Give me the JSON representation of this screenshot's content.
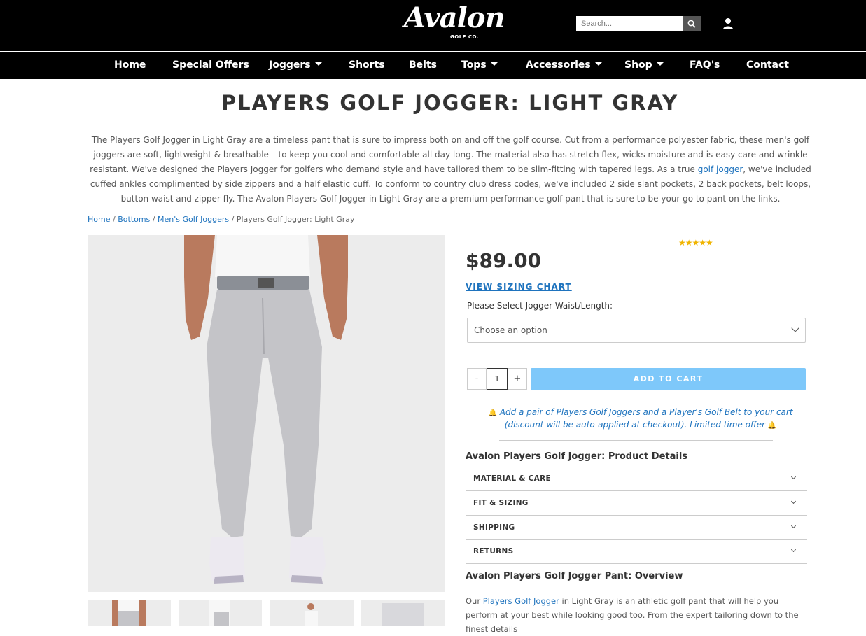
{
  "header": {
    "logo_script": "Avalon",
    "logo_sub": "GOLF CO.",
    "search_placeholder": "Search..."
  },
  "nav": [
    {
      "label": "Home",
      "dropdown": false
    },
    {
      "label": "Special Offers",
      "dropdown": false
    },
    {
      "label": "Joggers",
      "dropdown": true
    },
    {
      "label": "Shorts",
      "dropdown": false
    },
    {
      "label": "Belts",
      "dropdown": false
    },
    {
      "label": "Tops",
      "dropdown": true
    },
    {
      "label": "Accessories",
      "dropdown": true
    },
    {
      "label": "Shop",
      "dropdown": true
    },
    {
      "label": "FAQ's",
      "dropdown": false
    },
    {
      "label": "Contact",
      "dropdown": false
    }
  ],
  "product": {
    "title": "PLAYERS GOLF JOGGER: LIGHT GRAY",
    "desc_part1": "The Players Golf Jogger in Light Gray are a timeless pant that is sure to impress both on and off the golf course. Cut from a performance polyester fabric, these men's golf joggers are soft, lightweight & breathable – to keep you cool and comfortable all day long. The material also has stretch flex, wicks moisture and is easy care and wrinkle resistant. We've designed the Players Jogger for golfers who demand style and have tailored them to be slim-fitting with tapered legs. As a true ",
    "desc_link": "golf jogger",
    "desc_part2": ", we've included cuffed ankles complimented by side zippers and a half elastic cuff. To conform to country club dress codes, we've included 2 side slant pockets, 2 back pockets, belt loops, button waist and zipper fly. The Avalon Players Golf Jogger in Light Gray are a premium performance golf pant that is sure to be your go to pant on the links.",
    "rating": 5,
    "stars": "★★★★★",
    "price": "$89.00",
    "sizing_link": "VIEW SIZING CHART",
    "select_label": "Please Select Jogger Waist/Length:",
    "select_value": "Choose an option",
    "qty_minus": "-",
    "qty_value": "1",
    "qty_plus": "+",
    "add_to_cart": "ADD TO CART"
  },
  "breadcrumb": {
    "home": "Home",
    "bottoms": "Bottoms",
    "mens_joggers": "Men's Golf Joggers",
    "current": "Players Golf Jogger: Light Gray",
    "sep": "/"
  },
  "promo": {
    "part1": "Add a pair of Players Golf Joggers and a ",
    "link": "Player's Golf Belt",
    "part2": " to your cart (discount will be auto-applied at checkout). Limited time offer"
  },
  "details": {
    "title": "Avalon Players Golf Jogger: Product Details",
    "sections": [
      "MATERIAL & CARE",
      "FIT & SIZING",
      "SHIPPING",
      "RETURNS"
    ]
  },
  "overview": {
    "title": "Avalon Players Golf Jogger Pant: Overview",
    "part1": "Our ",
    "link": "Players Golf Jogger",
    "part2": " in Light Gray is an athletic golf pant that will help you perform at your best while looking good too. From the expert tailoring down to the finest details"
  },
  "colors": {
    "header_bg": "#000000",
    "link": "#1e73be",
    "add_to_cart": "#7ec8fa",
    "star": "#f0b400",
    "pant": "#c4c4c8"
  }
}
